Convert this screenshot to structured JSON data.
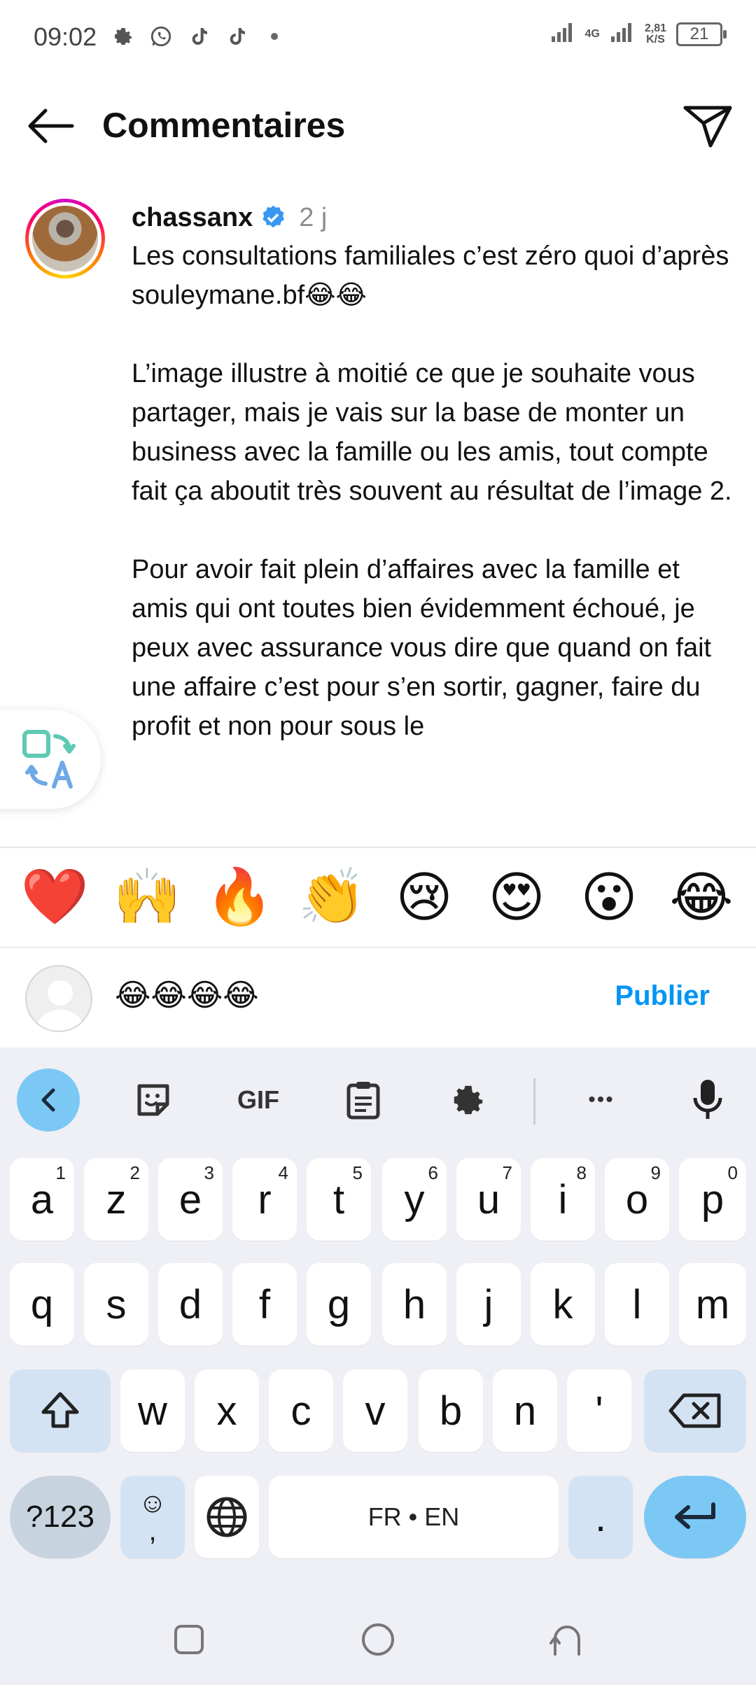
{
  "status_bar": {
    "time": "09:02",
    "network_type": "4G",
    "network_speed": "2,81",
    "network_speed_unit": "K/S",
    "battery": "21"
  },
  "header": {
    "title": "Commentaires"
  },
  "comment": {
    "username": "chassanx",
    "verified": true,
    "time_ago": "2 j",
    "text": "Les consultations familiales c’est zéro quoi d’après souleymane.bf😂😂\n\nL’image illustre à moitié ce que je souhaite vous partager, mais je vais sur la base de monter un business avec la famille ou les amis, tout compte fait ça aboutit très souvent au résultat de l’image 2.\n\nPour avoir fait plein d’affaires avec la famille et amis qui ont toutes bien évidemment échoué, je peux avec assurance vous dire que quand on fait une affaire c’est pour s’en sortir, gagner, faire du profit et non pour sous le"
  },
  "reactions": [
    "❤️",
    "🙌",
    "🔥",
    "👏",
    "😢",
    "😍",
    "😮",
    "😂"
  ],
  "comment_input": {
    "value": "😂😂😂😂",
    "publish_label": "Publier"
  },
  "keyboard": {
    "toolbar": [
      "back",
      "sticker",
      "GIF",
      "clipboard",
      "settings",
      "more",
      "microphone"
    ],
    "gif_label": "GIF",
    "more_label": "•••",
    "row1": [
      {
        "k": "a",
        "s": "1"
      },
      {
        "k": "z",
        "s": "2"
      },
      {
        "k": "e",
        "s": "3"
      },
      {
        "k": "r",
        "s": "4"
      },
      {
        "k": "t",
        "s": "5"
      },
      {
        "k": "y",
        "s": "6"
      },
      {
        "k": "u",
        "s": "7"
      },
      {
        "k": "i",
        "s": "8"
      },
      {
        "k": "o",
        "s": "9"
      },
      {
        "k": "p",
        "s": "0"
      }
    ],
    "row2": [
      "q",
      "s",
      "d",
      "f",
      "g",
      "h",
      "j",
      "k",
      "l",
      "m"
    ],
    "row3": [
      "w",
      "x",
      "c",
      "v",
      "b",
      "n",
      "'"
    ],
    "num_label": "?123",
    "emoji_comma_top": "☺",
    "emoji_comma_bottom": ",",
    "space_label": "FR • EN",
    "period_label": "."
  }
}
